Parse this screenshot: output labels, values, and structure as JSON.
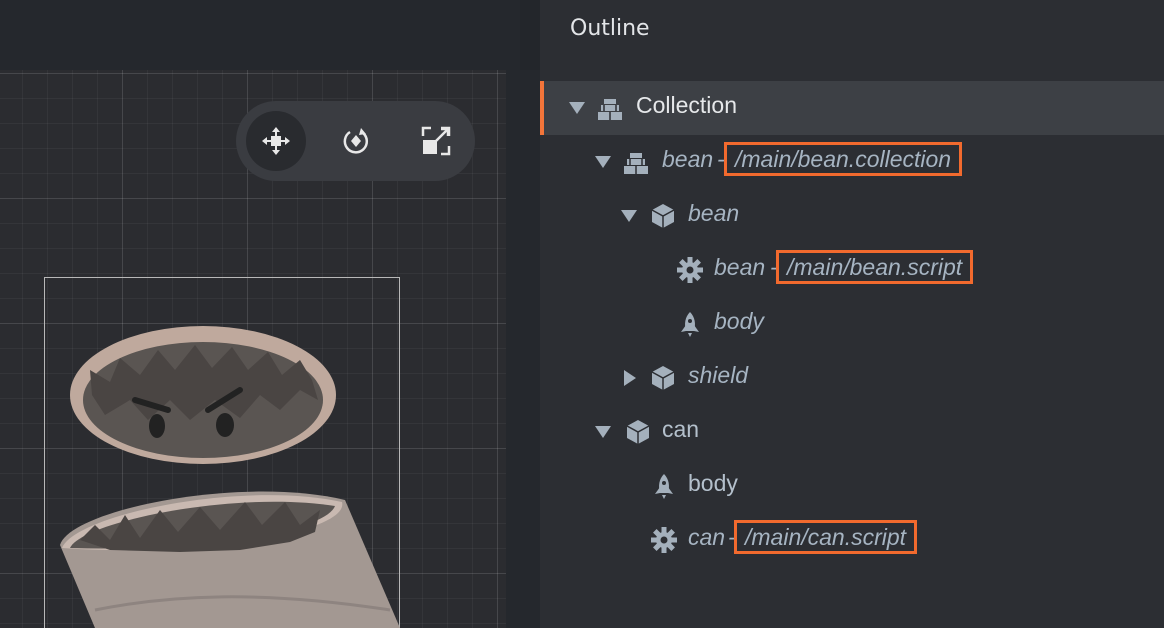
{
  "outline": {
    "title": "Outline",
    "rows": [
      {
        "label": "Collection",
        "icon": "collection-icon",
        "expanded": true,
        "selected": true
      },
      {
        "label": "bean",
        "sep": "-",
        "path": "/main/bean.collection",
        "icon": "collection-icon",
        "expanded": true
      },
      {
        "label": "bean",
        "icon": "game-object-icon",
        "expanded": true
      },
      {
        "label": "bean",
        "sep": "-",
        "path": "/main/bean.script",
        "icon": "gear-icon"
      },
      {
        "label": "body",
        "icon": "rocket-icon"
      },
      {
        "label": "shield",
        "icon": "game-object-icon",
        "expanded": false
      },
      {
        "label": "can",
        "icon": "game-object-icon",
        "expanded": true
      },
      {
        "label": "body",
        "icon": "rocket-icon"
      },
      {
        "label": "can",
        "sep": "-",
        "path": "/main/can.script",
        "icon": "gear-icon"
      }
    ]
  },
  "toolbar": {
    "tools": [
      {
        "name": "move-tool",
        "icon": "move-icon",
        "active": true
      },
      {
        "name": "rotate-tool",
        "icon": "rotate-icon",
        "active": false
      },
      {
        "name": "scale-tool",
        "icon": "scale-icon",
        "active": false
      }
    ]
  },
  "colors": {
    "accent": "#f26a2e",
    "panel": "#2c2e33",
    "text": "#a6b4c2"
  }
}
